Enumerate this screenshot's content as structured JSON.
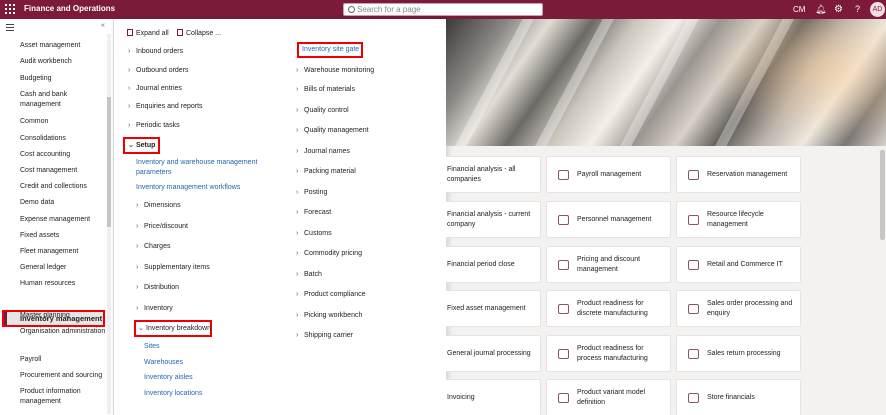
{
  "topbar": {
    "app_title": "Finance and Operations",
    "search_placeholder": "Search for a page",
    "company": "CM",
    "help": "?",
    "avatar_initials": "AD"
  },
  "modules": {
    "items": [
      "Asset management",
      "Audit workbench",
      "Budgeting",
      "Cash and bank management",
      "Common",
      "Consolidations",
      "Cost accounting",
      "Cost management",
      "Credit and collections",
      "Demo data",
      "Expense management",
      "Fixed assets",
      "Fleet management",
      "General ledger",
      "Human resources",
      "Inventory management",
      "Master planning",
      "Organisation administration",
      "Payroll",
      "Procurement and sourcing",
      "Product information management"
    ],
    "selected": "Inventory management"
  },
  "flyout": {
    "expand_all": "Expand all",
    "collapse": "Collapse ...",
    "col1": {
      "inbound_orders": "Inbound orders",
      "outbound_orders": "Outbound orders",
      "journal_entries": "Journal entries",
      "enquiries_reports": "Enquiries and reports",
      "periodic_tasks": "Periodic tasks",
      "setup": "Setup",
      "setup_link1": "Inventory and warehouse management parameters",
      "setup_link2": "Inventory management workflows",
      "dimensions": "Dimensions",
      "price_discount": "Price/discount",
      "charges": "Charges",
      "supplementary_items": "Supplementary items",
      "distribution": "Distribution",
      "inventory": "Inventory",
      "inventory_breakdown": "Inventory breakdown",
      "sites": "Sites",
      "warehouses": "Warehouses",
      "inventory_aisles": "Inventory aisles",
      "inventory_locations": "Inventory locations"
    },
    "col2": {
      "site_gate": "Inventory site gate",
      "items": [
        "Warehouse monitoring",
        "Bills of materials",
        "Quality control",
        "Quality management",
        "Journal names",
        "Packing material",
        "Posting",
        "Forecast",
        "Customs",
        "Commodity pricing",
        "Batch",
        "Product compliance",
        "Picking workbench",
        "Shipping carrier"
      ]
    }
  },
  "tiles": {
    "col1": [
      "Financial analysis - all companies",
      "Financial analysis - current company",
      "Financial period close",
      "Fixed asset management",
      "General journal processing",
      "Invoicing"
    ],
    "col2": [
      "Payroll management",
      "Personnel management",
      "Pricing and discount management",
      "Product readiness for discrete manufacturing",
      "Product readiness for process manufacturing",
      "Product variant model definition"
    ],
    "col3": [
      "Reservation management",
      "Resource lifecycle management",
      "Retail and Commerce IT",
      "Sales order processing and enquiry",
      "Sales return processing",
      "Store financials"
    ]
  },
  "colors": {
    "brand": "#7c1a3a",
    "link": "#2266b4",
    "highlight_box": "#ee0000"
  }
}
